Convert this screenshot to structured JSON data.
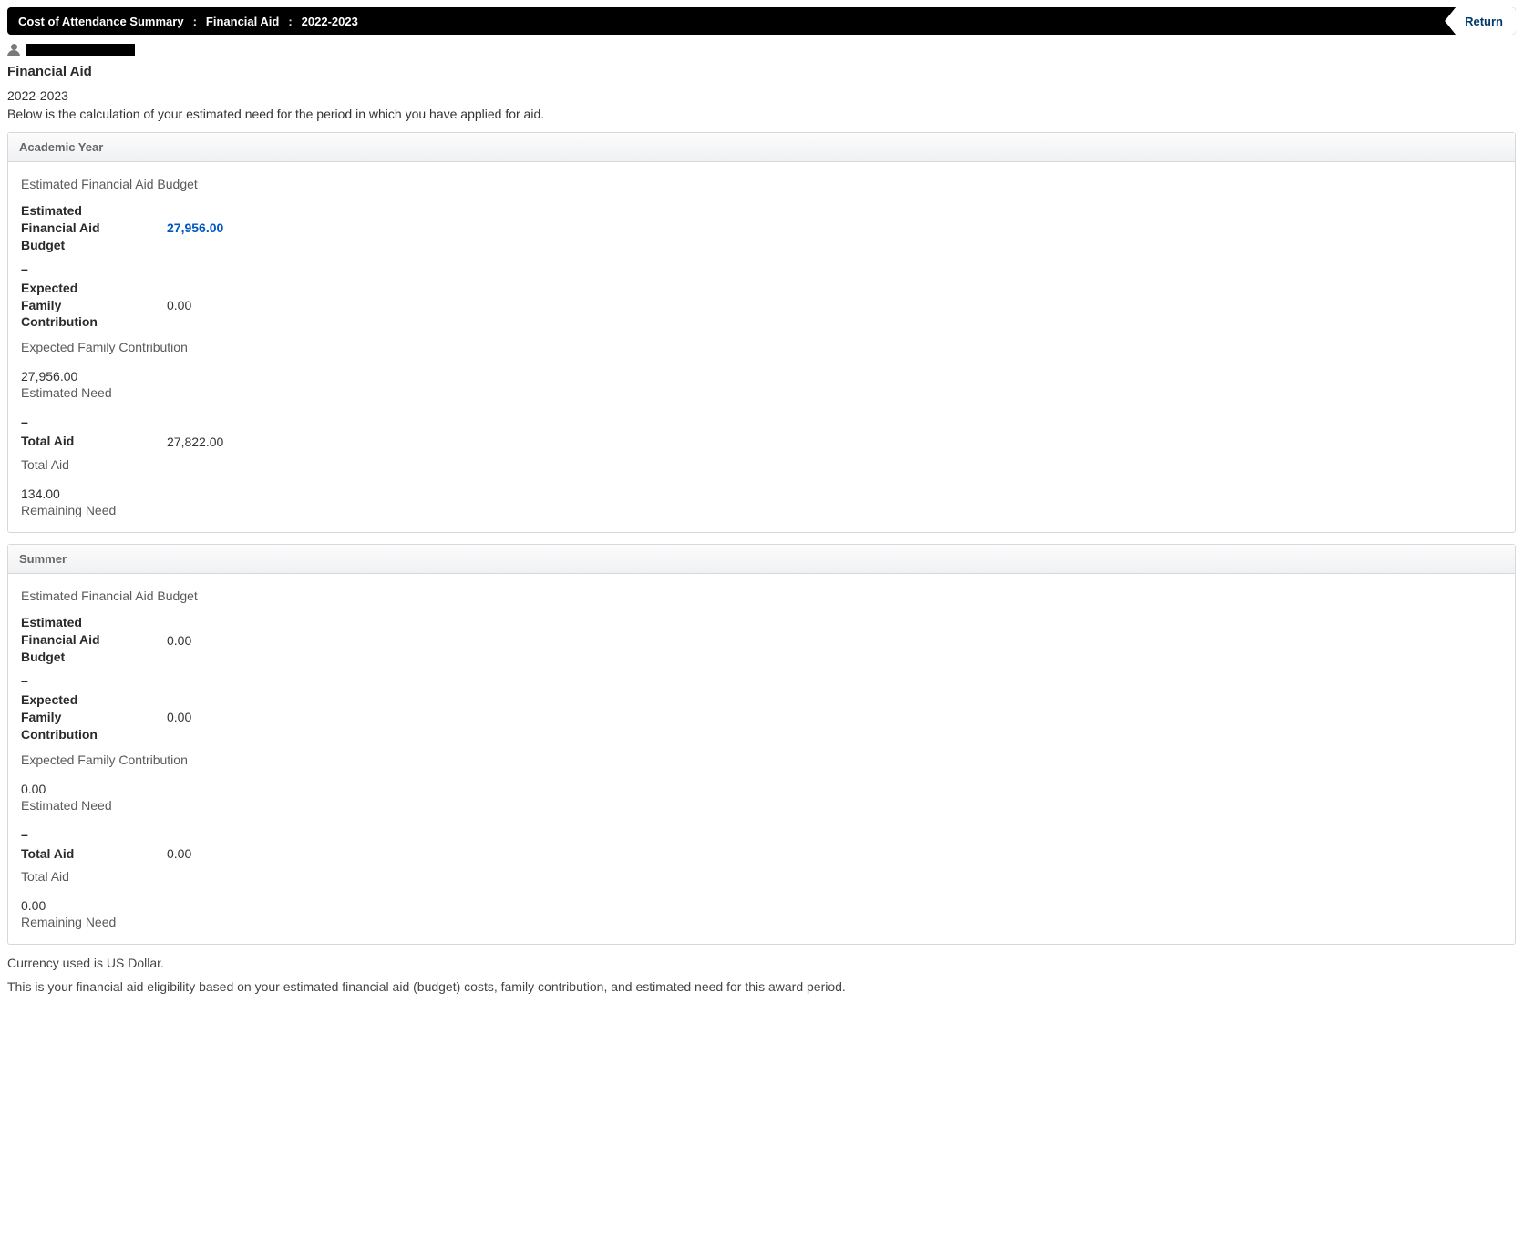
{
  "breadcrumb": {
    "items": [
      "Cost of Attendance Summary",
      "Financial Aid",
      "2022-2023"
    ]
  },
  "return_label": "Return",
  "page_title": "Financial Aid",
  "aid_year": "2022-2023",
  "intro": "Below is the calculation of your estimated need for the period in which you have applied for aid.",
  "panels": {
    "academic": {
      "header": "Academic Year",
      "subhead": "Estimated Financial Aid Budget",
      "budget_label": "Estimated Financial Aid Budget",
      "budget_value": "27,956.00",
      "efc_label": "Expected Family Contribution",
      "efc_value": "0.00",
      "efc_sub": "Expected Family Contribution",
      "est_need_value": "27,956.00",
      "est_need_label": "Estimated Need",
      "total_aid_label": "Total Aid",
      "total_aid_value": "27,822.00",
      "total_aid_sub": "Total Aid",
      "remaining_value": "134.00",
      "remaining_label": "Remaining Need"
    },
    "summer": {
      "header": "Summer",
      "subhead": "Estimated Financial Aid Budget",
      "budget_label": "Estimated Financial Aid Budget",
      "budget_value": "0.00",
      "efc_label": "Expected Family Contribution",
      "efc_value": "0.00",
      "efc_sub": "Expected Family Contribution",
      "est_need_value": "0.00",
      "est_need_label": "Estimated Need",
      "total_aid_label": "Total Aid",
      "total_aid_value": "0.00",
      "total_aid_sub": "Total Aid",
      "remaining_value": "0.00",
      "remaining_label": "Remaining Need"
    }
  },
  "currency_note": "Currency used is US Dollar.",
  "eligibility_note": "This is your financial aid eligibility based on your estimated financial aid (budget) costs, family contribution, and estimated need for this award period.",
  "minus": "–"
}
